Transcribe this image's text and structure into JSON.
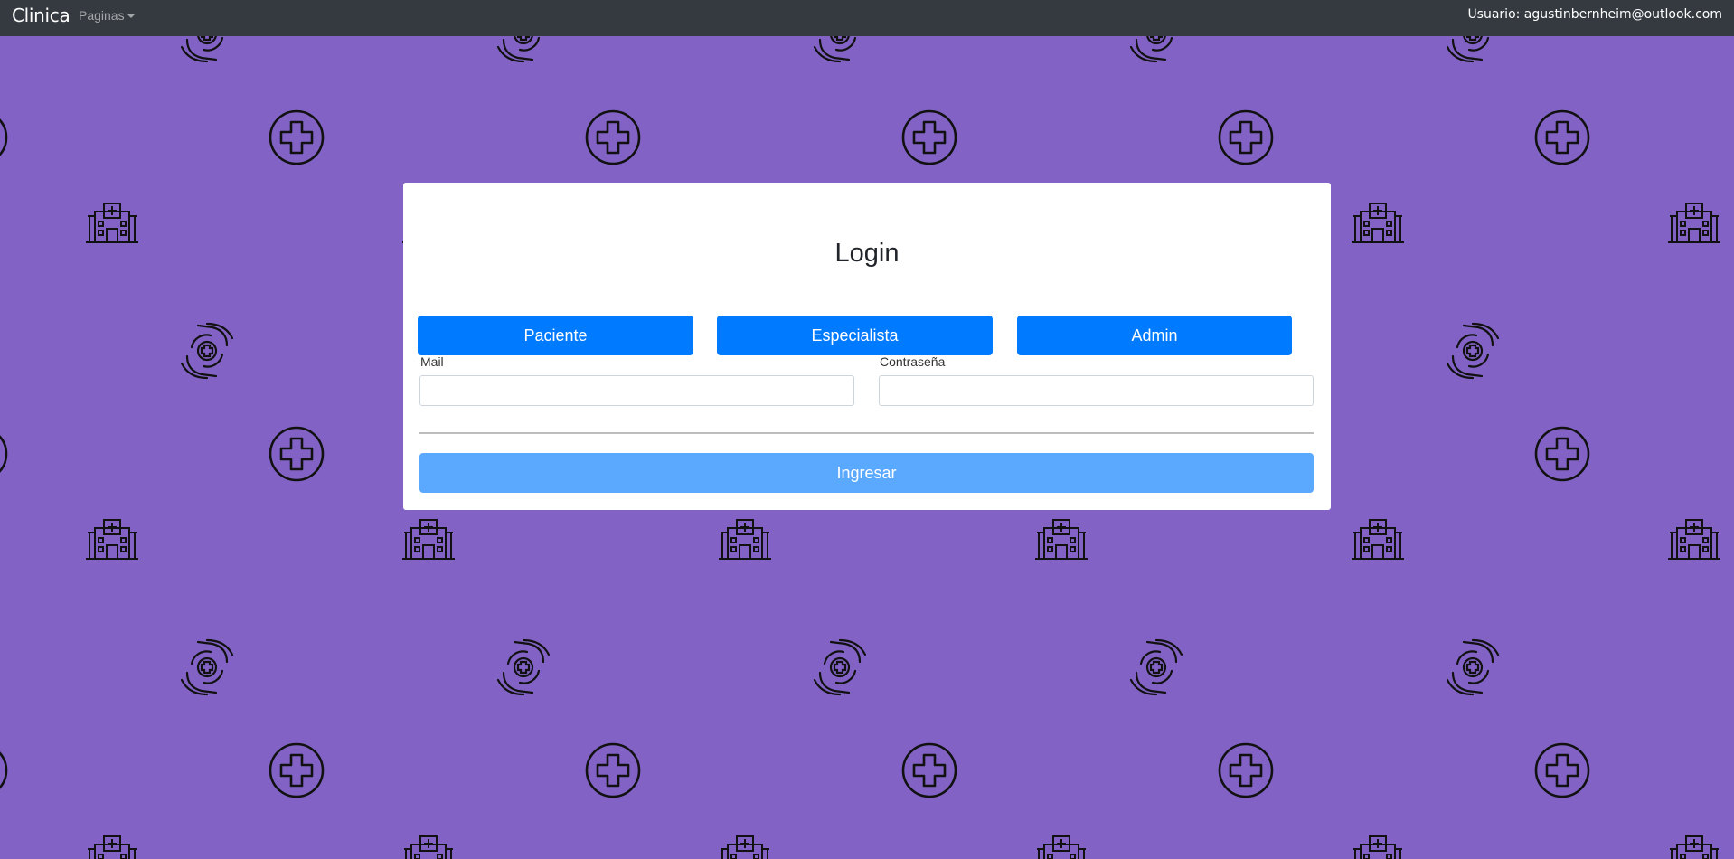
{
  "navbar": {
    "brand": "Clinica",
    "menu_label": "Paginas",
    "user_text": "Usuario: agustinbernheim@outlook.com"
  },
  "login": {
    "title": "Login",
    "role_buttons": [
      "Paciente",
      "Especialista",
      "Admin"
    ],
    "mail_label": "Mail",
    "mail_value": "",
    "password_label": "Contraseña",
    "password_value": "",
    "submit_label": "Ingresar"
  },
  "background": {
    "color": "#8263c5",
    "icons": [
      "hospital-icon",
      "medical-cross-icon",
      "healthcare-hands-icon"
    ]
  },
  "colors": {
    "navbar": "#343a40",
    "primary": "#007bff",
    "primary_disabled": "#5ba9ff"
  }
}
